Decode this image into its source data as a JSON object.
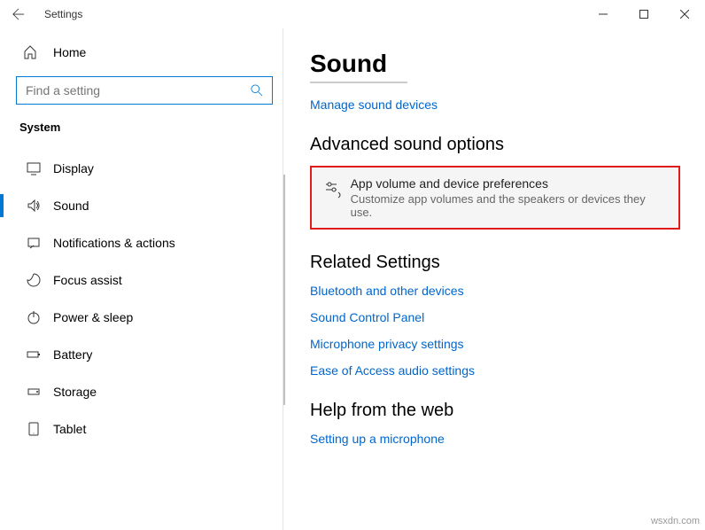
{
  "window": {
    "title": "Settings"
  },
  "sidebar": {
    "home": "Home",
    "search_placeholder": "Find a setting",
    "section": "System",
    "items": [
      {
        "label": "Display"
      },
      {
        "label": "Sound"
      },
      {
        "label": "Notifications & actions"
      },
      {
        "label": "Focus assist"
      },
      {
        "label": "Power & sleep"
      },
      {
        "label": "Battery"
      },
      {
        "label": "Storage"
      },
      {
        "label": "Tablet"
      }
    ]
  },
  "main": {
    "title": "Sound",
    "manage_link": "Manage sound devices",
    "advanced_heading": "Advanced sound options",
    "option": {
      "title": "App volume and device preferences",
      "desc": "Customize app volumes and the speakers or devices they use."
    },
    "related_heading": "Related Settings",
    "related_links": [
      "Bluetooth and other devices",
      "Sound Control Panel",
      "Microphone privacy settings",
      "Ease of Access audio settings"
    ],
    "help_heading": "Help from the web",
    "help_link": "Setting up a microphone"
  },
  "footer": "wsxdn.com"
}
